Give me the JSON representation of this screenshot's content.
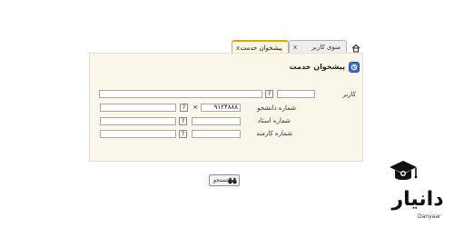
{
  "tabs": [
    {
      "label": "منوی کاربر",
      "close": "x"
    },
    {
      "label": "پیشخوان خدمت",
      "close": "x"
    }
  ],
  "section": {
    "title": "پیشخوان خدمت"
  },
  "form": {
    "user": {
      "label": "کاربر",
      "value": "",
      "help": "?"
    },
    "student_number": {
      "label": "شماره دانشجو",
      "value": "۹۱۲۴۸۸۸",
      "clear": "×",
      "help": "?"
    },
    "professor_number": {
      "label": "شماره استاد",
      "value": "",
      "help": "?"
    },
    "employee_number": {
      "label": "شماره کارمند",
      "value": "",
      "help": "?"
    }
  },
  "actions": {
    "search_label": "جستجو"
  },
  "logo": {
    "text": "دانیار",
    "subtext": "Danyaar"
  },
  "colors": {
    "accent": "#e0a800",
    "panel": "#faf6ea",
    "icon_blue": "#3c6cc4"
  }
}
